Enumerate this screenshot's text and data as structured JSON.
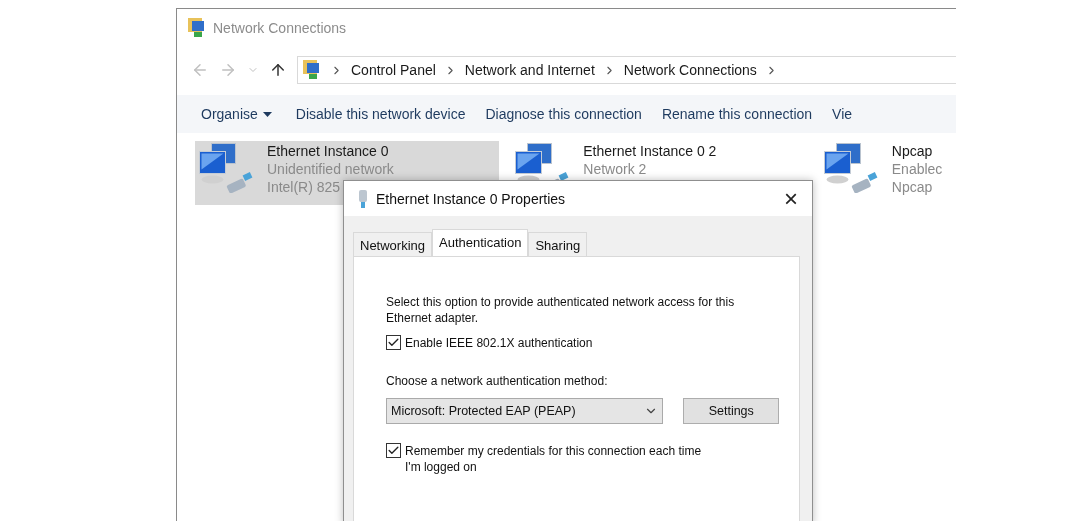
{
  "window": {
    "title": "Network Connections"
  },
  "address_bar": {
    "crumbs": [
      "Control Panel",
      "Network and Internet",
      "Network Connections"
    ]
  },
  "toolbar": {
    "items": [
      {
        "label": "Organise",
        "kind": "menu"
      },
      {
        "label": "Disable this network device",
        "kind": "command"
      },
      {
        "label": "Diagnose this connection",
        "kind": "command"
      },
      {
        "label": "Rename this connection",
        "kind": "command"
      },
      {
        "label": "Vie",
        "kind": "command"
      }
    ]
  },
  "connections": [
    {
      "name": "Ethernet Instance 0",
      "status": "Unidentified network",
      "device": "Intel(R) 825",
      "selected": true
    },
    {
      "name": "Ethernet Instance 0 2",
      "status": "Network 2",
      "selected": false
    },
    {
      "name": "Npcap",
      "status": "Enablec",
      "device": "Npcap",
      "selected": false
    }
  ],
  "dialog": {
    "title": "Ethernet Instance 0 Properties",
    "close": "×",
    "tabs": [
      {
        "label": "Networking",
        "selected": false
      },
      {
        "label": "Authentication",
        "selected": true
      },
      {
        "label": "Sharing",
        "selected": false
      }
    ],
    "description": "Select this option to provide authenticated network access for this Ethernet adapter.",
    "enable_checkbox": {
      "label": "Enable IEEE 802.1X authentication",
      "checked": true
    },
    "method_label": "Choose a network authentication method:",
    "method_select": {
      "value": "Microsoft: Protected EAP (PEAP)"
    },
    "settings_button": "Settings",
    "remember_checkbox": {
      "label": "Remember my credentials for this connection each time I'm logged on",
      "checked": true
    }
  }
}
